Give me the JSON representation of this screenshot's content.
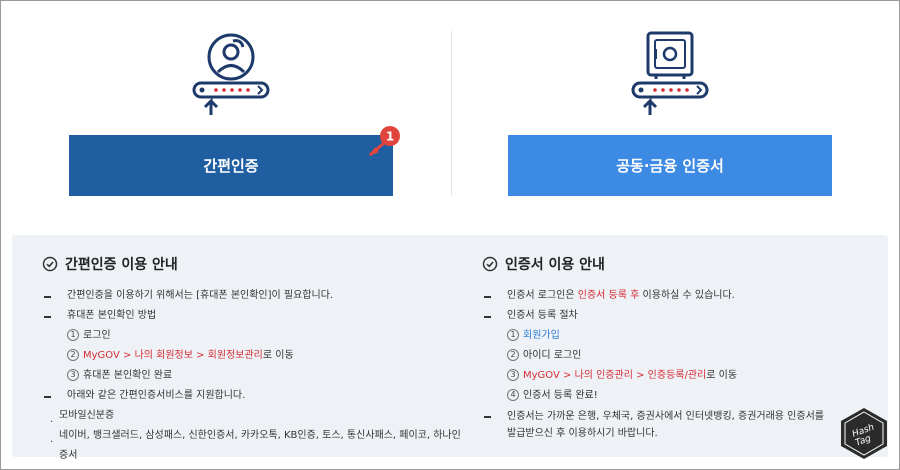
{
  "buttons": {
    "easy_auth": "간편인증",
    "joint_cert": "공동·금융 인증서"
  },
  "marker_number": "1",
  "guide": {
    "left": {
      "title": "간편인증 이용 안내",
      "item1": "간편인증을 이용하기 위해서는 [휴대폰 본인확인]이 필요합니다.",
      "item2": "휴대폰 본인확인 방법",
      "step1_num": "1",
      "step1": "로그인",
      "step2_num": "2",
      "step2_red": "MyGOV > 나의 회원정보 > 회원정보관리",
      "step2_tail": "로 이동",
      "step3_num": "3",
      "step3": "휴대폰 본인확인 완료",
      "item3": "아래와 같은 간편인증서비스를 지원합니다.",
      "bullet1": "모바일신분증",
      "bullet2": "네이버, 뱅크샐러드, 삼성패스, 신한인증서, 카카오톡, KB인증, 토스, 통신사패스, 페이코, 하나인증서"
    },
    "right": {
      "title": "인증서 이용 안내",
      "item1_pre": "인증서 로그인은 ",
      "item1_red": "인증서 등록 후",
      "item1_post": " 이용하실 수 있습니다.",
      "item2": "인증서 등록 절차",
      "step1_num": "1",
      "step1": "회원가입",
      "step2_num": "2",
      "step2": "아이디 로그인",
      "step3_num": "3",
      "step3_red": "MyGOV > 나의 인증관리 > 인증등록/관리",
      "step3_tail": "로 이동",
      "step4_num": "4",
      "step4": "인증서 등록 완료!",
      "item3_line1": "인증서는 가까운 은행, 우체국, 증권사에서 인터넷뱅킹, 증권거래용 인증서를",
      "item3_line2": "발급받으신 후 이용하시기 바랍니다."
    }
  },
  "watermark": {
    "line1": "Hash",
    "line2": "Tag"
  },
  "colors": {
    "easy_button": "#1f5ea0",
    "cert_button": "#3c8ae4",
    "highlight_red": "#d62b35",
    "link_blue": "#2f7bd6",
    "marker_red": "#e0443c",
    "icon_navy": "#1d3a6b"
  },
  "icons": [
    "user-auth-icon",
    "safe-cert-icon",
    "check-circle-icon",
    "step-marker-icon",
    "hashtag-logo-icon"
  ]
}
